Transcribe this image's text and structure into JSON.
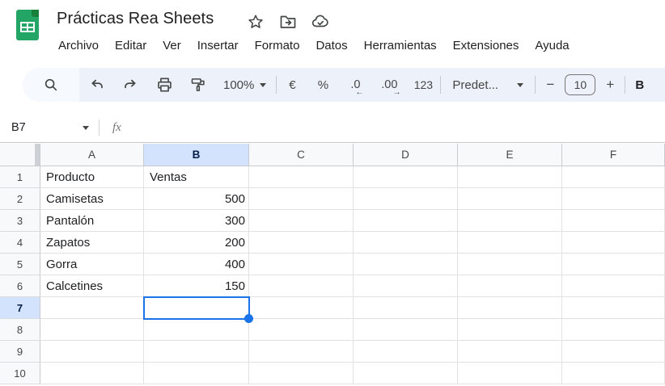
{
  "header": {
    "title": "Prácticas Rea Sheets",
    "menu_items": [
      "Archivo",
      "Editar",
      "Ver",
      "Insertar",
      "Formato",
      "Datos",
      "Herramientas",
      "Extensiones",
      "Ayuda"
    ]
  },
  "toolbar": {
    "zoom": "100%",
    "currency": "€",
    "percent": "%",
    "decrease_decimals": ".0",
    "decrease_decimals_arrow": "←",
    "increase_decimals": ".00",
    "increase_decimals_arrow": "→",
    "more_formats": "123",
    "font": "Predet...",
    "decrease_font_size": "−",
    "font_size": "10",
    "increase_font_size": "+",
    "bold": "B"
  },
  "formula_bar": {
    "cell_ref": "B7",
    "fx": "fx"
  },
  "sheet": {
    "columns": [
      "A",
      "B",
      "C",
      "D",
      "E",
      "F"
    ],
    "rows": [
      "1",
      "2",
      "3",
      "4",
      "5",
      "6",
      "7",
      "8",
      "9",
      "10"
    ],
    "selected_column_index": 1,
    "selected_row_index": 6,
    "selected_cell": "B7",
    "cells": {
      "A1": "Producto",
      "B1": "Ventas",
      "A2": "Camisetas",
      "B2": "500",
      "A3": "Pantalón",
      "B3": "300",
      "A4": "Zapatos",
      "B4": "200",
      "A5": "Gorra",
      "B5": "400",
      "A6": "Calcetines",
      "B6": "150"
    }
  },
  "colors": {
    "accent_blue": "#1a73e8",
    "selected_header_bg": "#d3e3fd",
    "selected_header_text": "#041e49",
    "toolbar_bg": "#edf2fa",
    "logo_green": "#23a566",
    "logo_green_dark": "#188038",
    "icon_gray": "#444746",
    "gridline": "#e2e2e2"
  }
}
